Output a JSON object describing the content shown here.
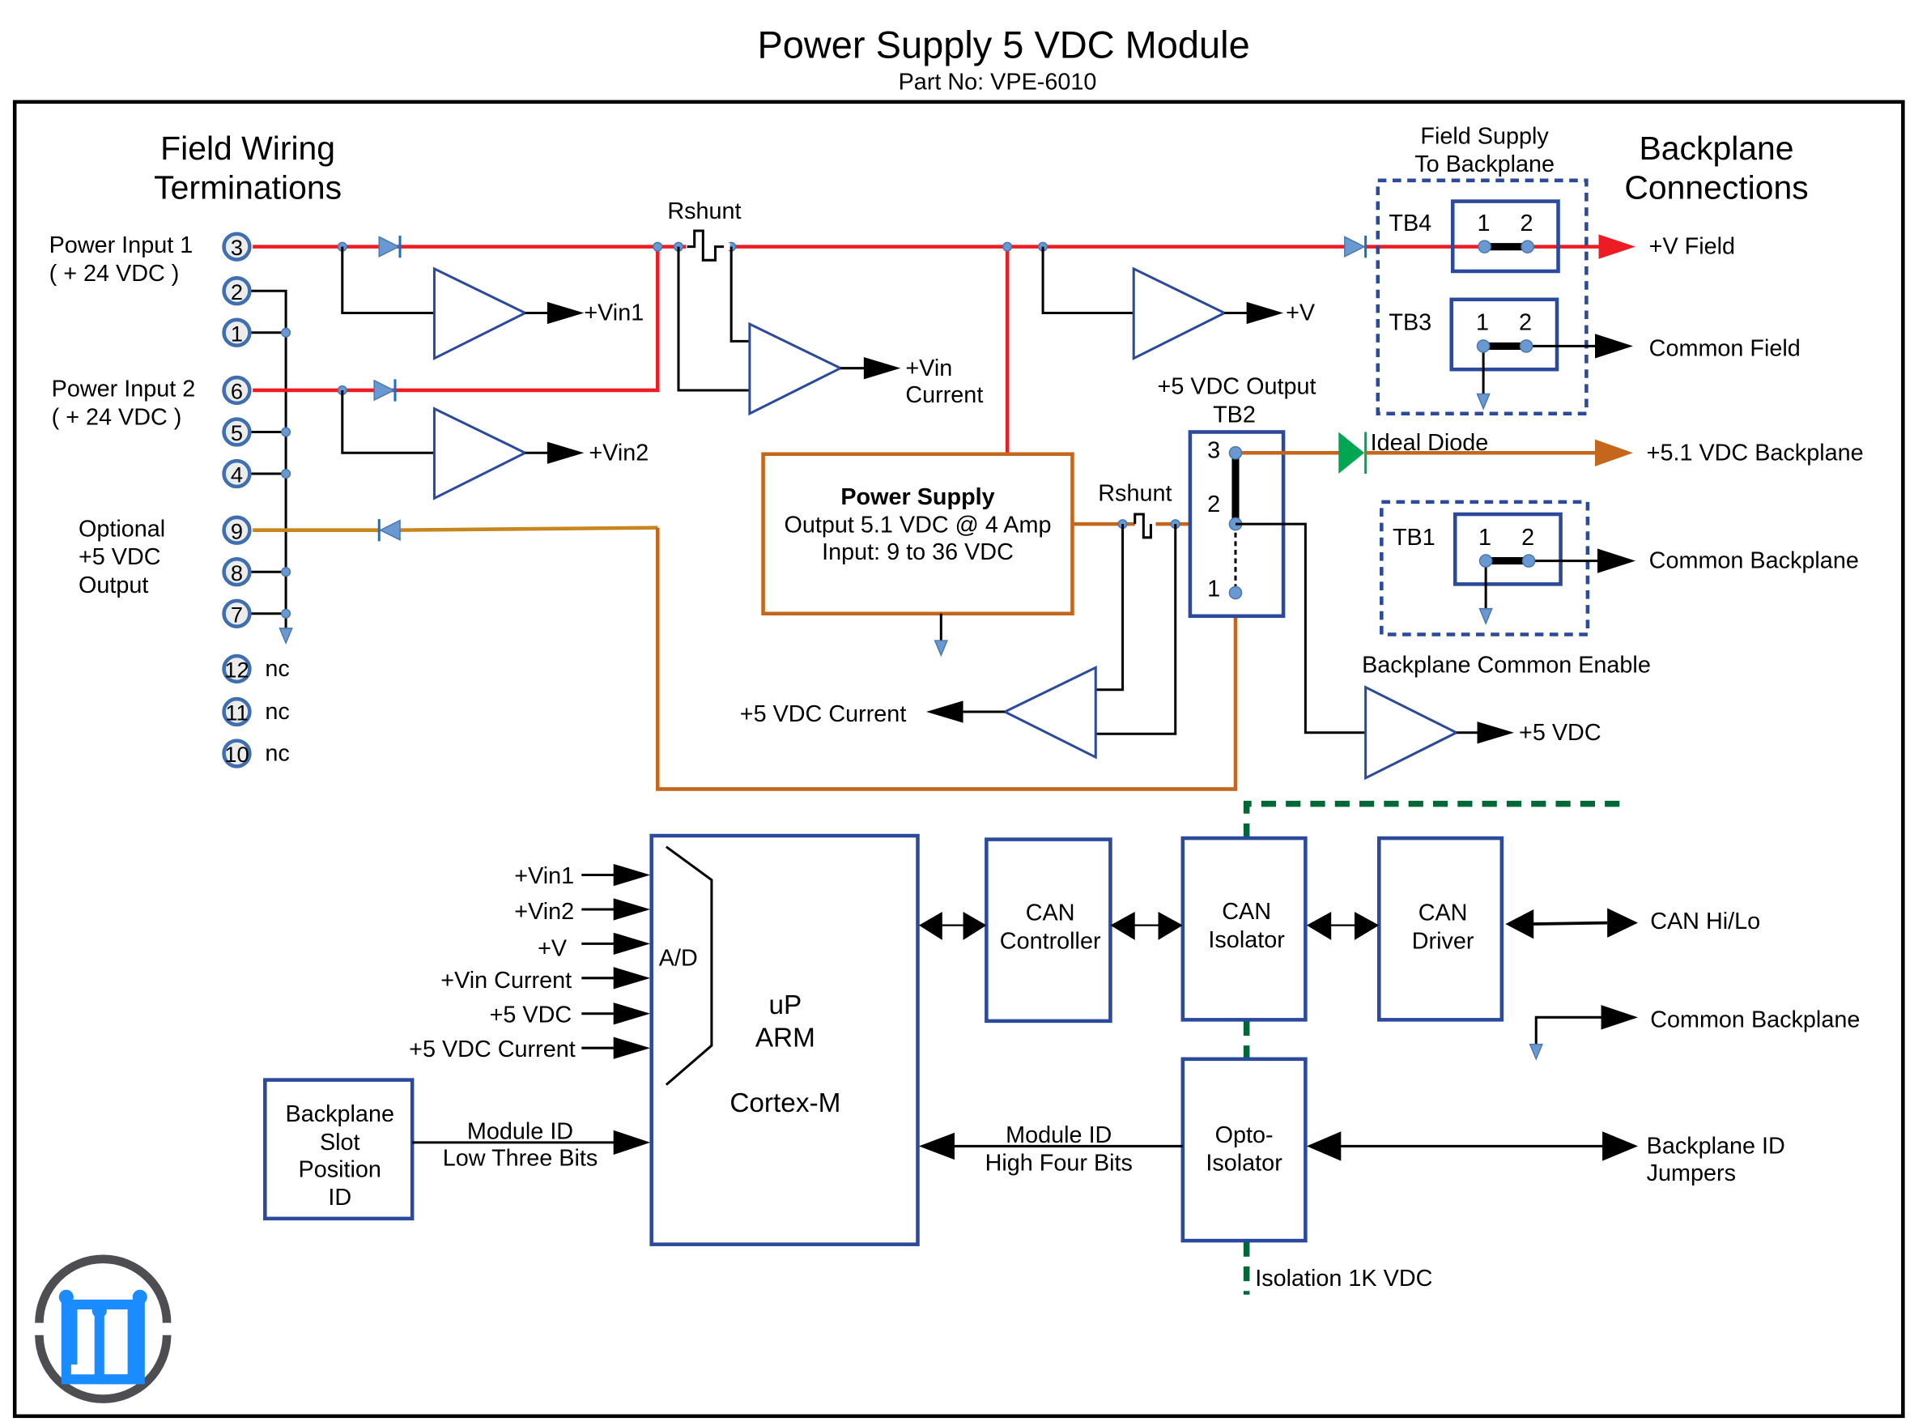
{
  "title": "Power Supply 5 VDC Module",
  "part_no": "Part No: VPE-6010",
  "sections": {
    "field_wiring_line1": "Field Wiring",
    "field_wiring_line2": "Terminations",
    "backplane_conn_line1": "Backplane",
    "backplane_conn_line2": "Connections",
    "field_supply_line1": "Field Supply",
    "field_supply_line2": "To Backplane"
  },
  "field_labels": {
    "power_input_1": "Power Input 1",
    "power_input_1_v": "( + 24 VDC )",
    "power_input_2": "Power Input 2",
    "power_input_2_v": "( + 24 VDC )",
    "optional_1": "Optional",
    "optional_2": "+5 VDC",
    "optional_3": "Output"
  },
  "terminals": [
    "3",
    "2",
    "1",
    "6",
    "5",
    "4",
    "9",
    "8",
    "7",
    "12",
    "11",
    "10"
  ],
  "nc_label": "nc",
  "amp_outputs": {
    "vin1": "+Vin1",
    "vin2": "+Vin2",
    "vin_current_1": "+Vin",
    "vin_current_2": "Current",
    "v": "+V",
    "v5_current": "+5 VDC Current",
    "v5": "+5 VDC"
  },
  "rshunt": "Rshunt",
  "power_supply": {
    "title": "Power Supply",
    "line1": "Output 5.1 VDC @ 4 Amp",
    "line2": "Input: 9 to 36 VDC"
  },
  "tb2": {
    "header1": "+5 VDC Output",
    "header2": "TB2",
    "pins": [
      "3",
      "2",
      "1"
    ]
  },
  "tb4": {
    "label": "TB4",
    "pin1": "1",
    "pin2": "2"
  },
  "tb3": {
    "label": "TB3",
    "pin1": "1",
    "pin2": "2"
  },
  "tb1": {
    "label": "TB1",
    "pin1": "1",
    "pin2": "2"
  },
  "backplane_outputs": {
    "v_field": "+V Field",
    "common_field": "Common Field",
    "ideal_diode": "Ideal Diode",
    "v51_backplane": "+5.1 VDC Backplane",
    "common_backplane": "Common Backplane",
    "backplane_common_enable": "Backplane Common Enable",
    "can_hilo": "CAN Hi/Lo",
    "common_backplane_2": "Common Backplane",
    "backplane_id_1": "Backplane ID",
    "backplane_id_2": "Jumpers"
  },
  "mcu": {
    "adc": "A/D",
    "line1": "uP",
    "line2": "ARM",
    "line3": "Cortex-M",
    "inputs": [
      "+Vin1",
      "+Vin2",
      "+V",
      "+Vin Current",
      "+5 VDC",
      "+5 VDC Current"
    ]
  },
  "slot_box": [
    "Backplane",
    "Slot",
    "Position",
    "ID"
  ],
  "module_id_low": [
    "Module ID",
    "Low Three Bits"
  ],
  "module_id_high": [
    "Module ID",
    "High Four Bits"
  ],
  "blocks": {
    "can_controller": [
      "CAN",
      "Controller"
    ],
    "can_isolator": [
      "CAN",
      "Isolator"
    ],
    "can_driver": [
      "CAN",
      "Driver"
    ],
    "opto_isolator": [
      "Opto-",
      "Isolator"
    ]
  },
  "isolation": "Isolation 1K VDC",
  "colors": {
    "field_power": "#ed1c24",
    "output_5v": "#c4661c",
    "optional_5v": "#c8861e",
    "block_outline": "#2b4a9c",
    "isolation": "#006837",
    "ideal_diode": "#00a651",
    "logo_ring": "#4d4d52",
    "logo_mark": "#1a8cff"
  }
}
